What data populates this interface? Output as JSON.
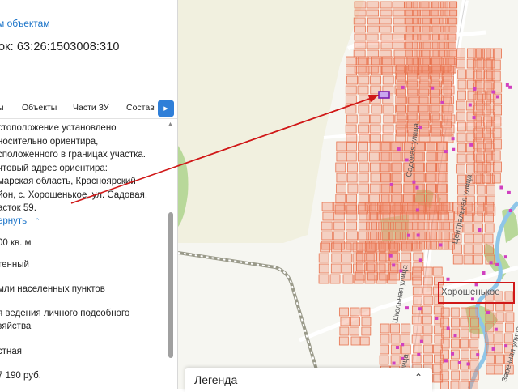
{
  "panel": {
    "back_link": "м объектам",
    "title": "ок: 63:26:1503008:310",
    "tabs": [
      "ы",
      "Объекты",
      "Части ЗУ",
      "Состав"
    ],
    "tab_next_icon": "chevron-right-icon",
    "description_lines": [
      "стоположение установлено",
      "носительно ориентира,",
      "сположенного в границах участка.",
      "чтовый адрес ориентира:",
      "марская область, Красноярский",
      "йон, с. Хорошенькое, ул. Садовая,",
      "асток 59."
    ],
    "collapse_link": "ернуть",
    "fields": [
      "00 кв. м",
      "тенный",
      "мли населенных пунктов",
      "я ведения личного подсобного",
      "зяйства",
      "стная",
      "7 190 руб."
    ]
  },
  "map": {
    "place_label": "Хорошенькое",
    "streets": [
      "Садовая улица",
      "Центральная улица",
      "Школьная улица",
      "улица",
      "Заречная улица"
    ],
    "highlight_color": "#d01818",
    "parcel_color": "#f28a6b",
    "building_color": "#d040c0",
    "legend_title": "Легенда",
    "legend_toggle_icon": "chevron-updown-icon"
  }
}
